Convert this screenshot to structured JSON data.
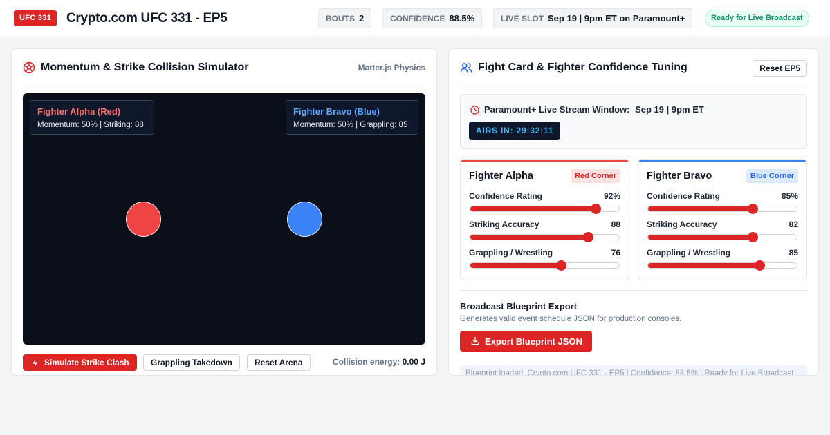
{
  "header": {
    "event_badge": "UFC 331",
    "title": "Crypto.com UFC 331 - EP5",
    "stats": [
      {
        "key": "BOUTS",
        "value": "2"
      },
      {
        "key": "CONFIDENCE",
        "value": "88.5%"
      },
      {
        "key": "LIVE SLOT",
        "value": "Sep 19 | 9pm ET on Paramount+"
      }
    ],
    "status": "Ready for Live Broadcast"
  },
  "simulator": {
    "title": "Momentum & Strike Collision Simulator",
    "engine": "Matter.js Physics",
    "fighter_a": {
      "name": "Fighter Alpha (Red)",
      "stats": "Momentum: 50% | Striking: 88",
      "color": "#f87171"
    },
    "fighter_b": {
      "name": "Fighter Bravo (Blue)",
      "stats": "Momentum: 50% | Grappling: 85",
      "color": "#60a5fa"
    },
    "ball_colors": {
      "red": "#ef4444",
      "blue": "#3b82f6"
    },
    "buttons": {
      "strike": "Simulate Strike Clash",
      "takedown": "Grappling Takedown",
      "reset": "Reset Arena"
    },
    "energy_label": "Collision energy:",
    "energy_value": "0.00 J"
  },
  "tuning": {
    "title": "Fight Card & Fighter Confidence Tuning",
    "reset_label": "Reset EP5",
    "window_label": "Paramount+ Live Stream Window:",
    "window_value": "Sep 19 | 9pm ET",
    "countdown": "AIRS IN: 29:32:11",
    "fighters": [
      {
        "name": "Fighter Alpha",
        "corner": "Red Corner",
        "accent": "#ef4444",
        "sliders": [
          {
            "label": "Confidence Rating",
            "value": "92%",
            "level": 0.84
          },
          {
            "label": "Striking Accuracy",
            "value": "88",
            "level": 0.79
          },
          {
            "label": "Grappling / Wrestling",
            "value": "76",
            "level": 0.61
          }
        ]
      },
      {
        "name": "Fighter Bravo",
        "corner": "Blue Corner",
        "accent": "#3b82f6",
        "sliders": [
          {
            "label": "Confidence Rating",
            "value": "85%",
            "level": 0.7
          },
          {
            "label": "Striking Accuracy",
            "value": "82",
            "level": 0.7
          },
          {
            "label": "Grappling / Wrestling",
            "value": "85",
            "level": 0.75
          }
        ]
      }
    ],
    "export": {
      "title": "Broadcast Blueprint Export",
      "subtitle": "Generates valid event schedule JSON for production consoles.",
      "button": "Export Blueprint JSON",
      "log": "Blueprint loaded: Crypto.com UFC 331 - EP5 | Confidence: 88.5% | Ready for Live Broadcast"
    }
  }
}
